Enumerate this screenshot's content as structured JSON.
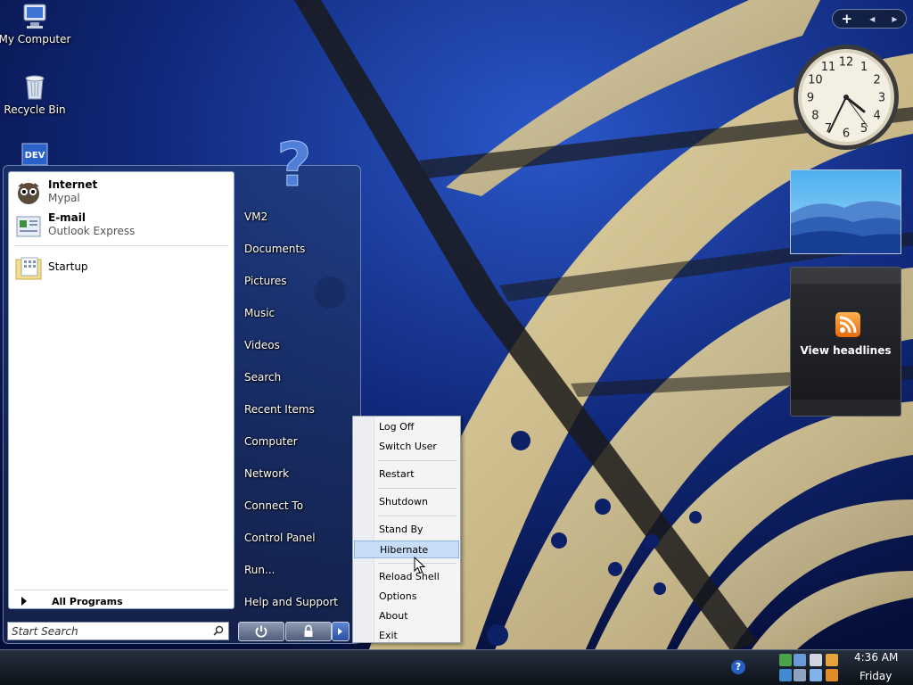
{
  "desktop": {
    "icons": [
      {
        "label": "My Computer"
      },
      {
        "label": "Recycle Bin"
      },
      {
        "label": "DEV"
      }
    ]
  },
  "gadgets": {
    "toolbar": {
      "add": "+",
      "prev": "◂",
      "next": "▸"
    },
    "clock": {
      "numbers": [
        "12",
        "1",
        "2",
        "3",
        "4",
        "5",
        "6",
        "7",
        "8",
        "9",
        "10",
        "11"
      ]
    },
    "feed": {
      "headline": "View headlines"
    }
  },
  "start_menu": {
    "pinned": [
      {
        "title": "Internet",
        "subtitle": "Mypal"
      },
      {
        "title": "E-mail",
        "subtitle": "Outlook Express"
      }
    ],
    "recent": [
      {
        "label": "Startup"
      }
    ],
    "all_programs": "All Programs",
    "search_placeholder": "Start Search",
    "right_items": [
      "VM2",
      "Documents",
      "Pictures",
      "Music",
      "Videos",
      "Search",
      "Recent Items",
      "Computer",
      "Network",
      "Connect To",
      "Control Panel",
      "Run...",
      "Help and Support"
    ],
    "help_glyph": "?"
  },
  "power_menu": {
    "items": [
      "Log Off",
      "Switch User",
      "Restart",
      "Shutdown",
      "Stand By",
      "Hibernate",
      "Reload Shell",
      "Options",
      "About",
      "Exit"
    ],
    "highlighted": "Hibernate"
  },
  "taskbar": {
    "help_glyph": "?",
    "time": "4:36 AM",
    "day": "Friday"
  },
  "colors": {
    "sky": "#0b1c5a",
    "arch": "#e8d6a0",
    "highlight": "#c6dcf7"
  }
}
